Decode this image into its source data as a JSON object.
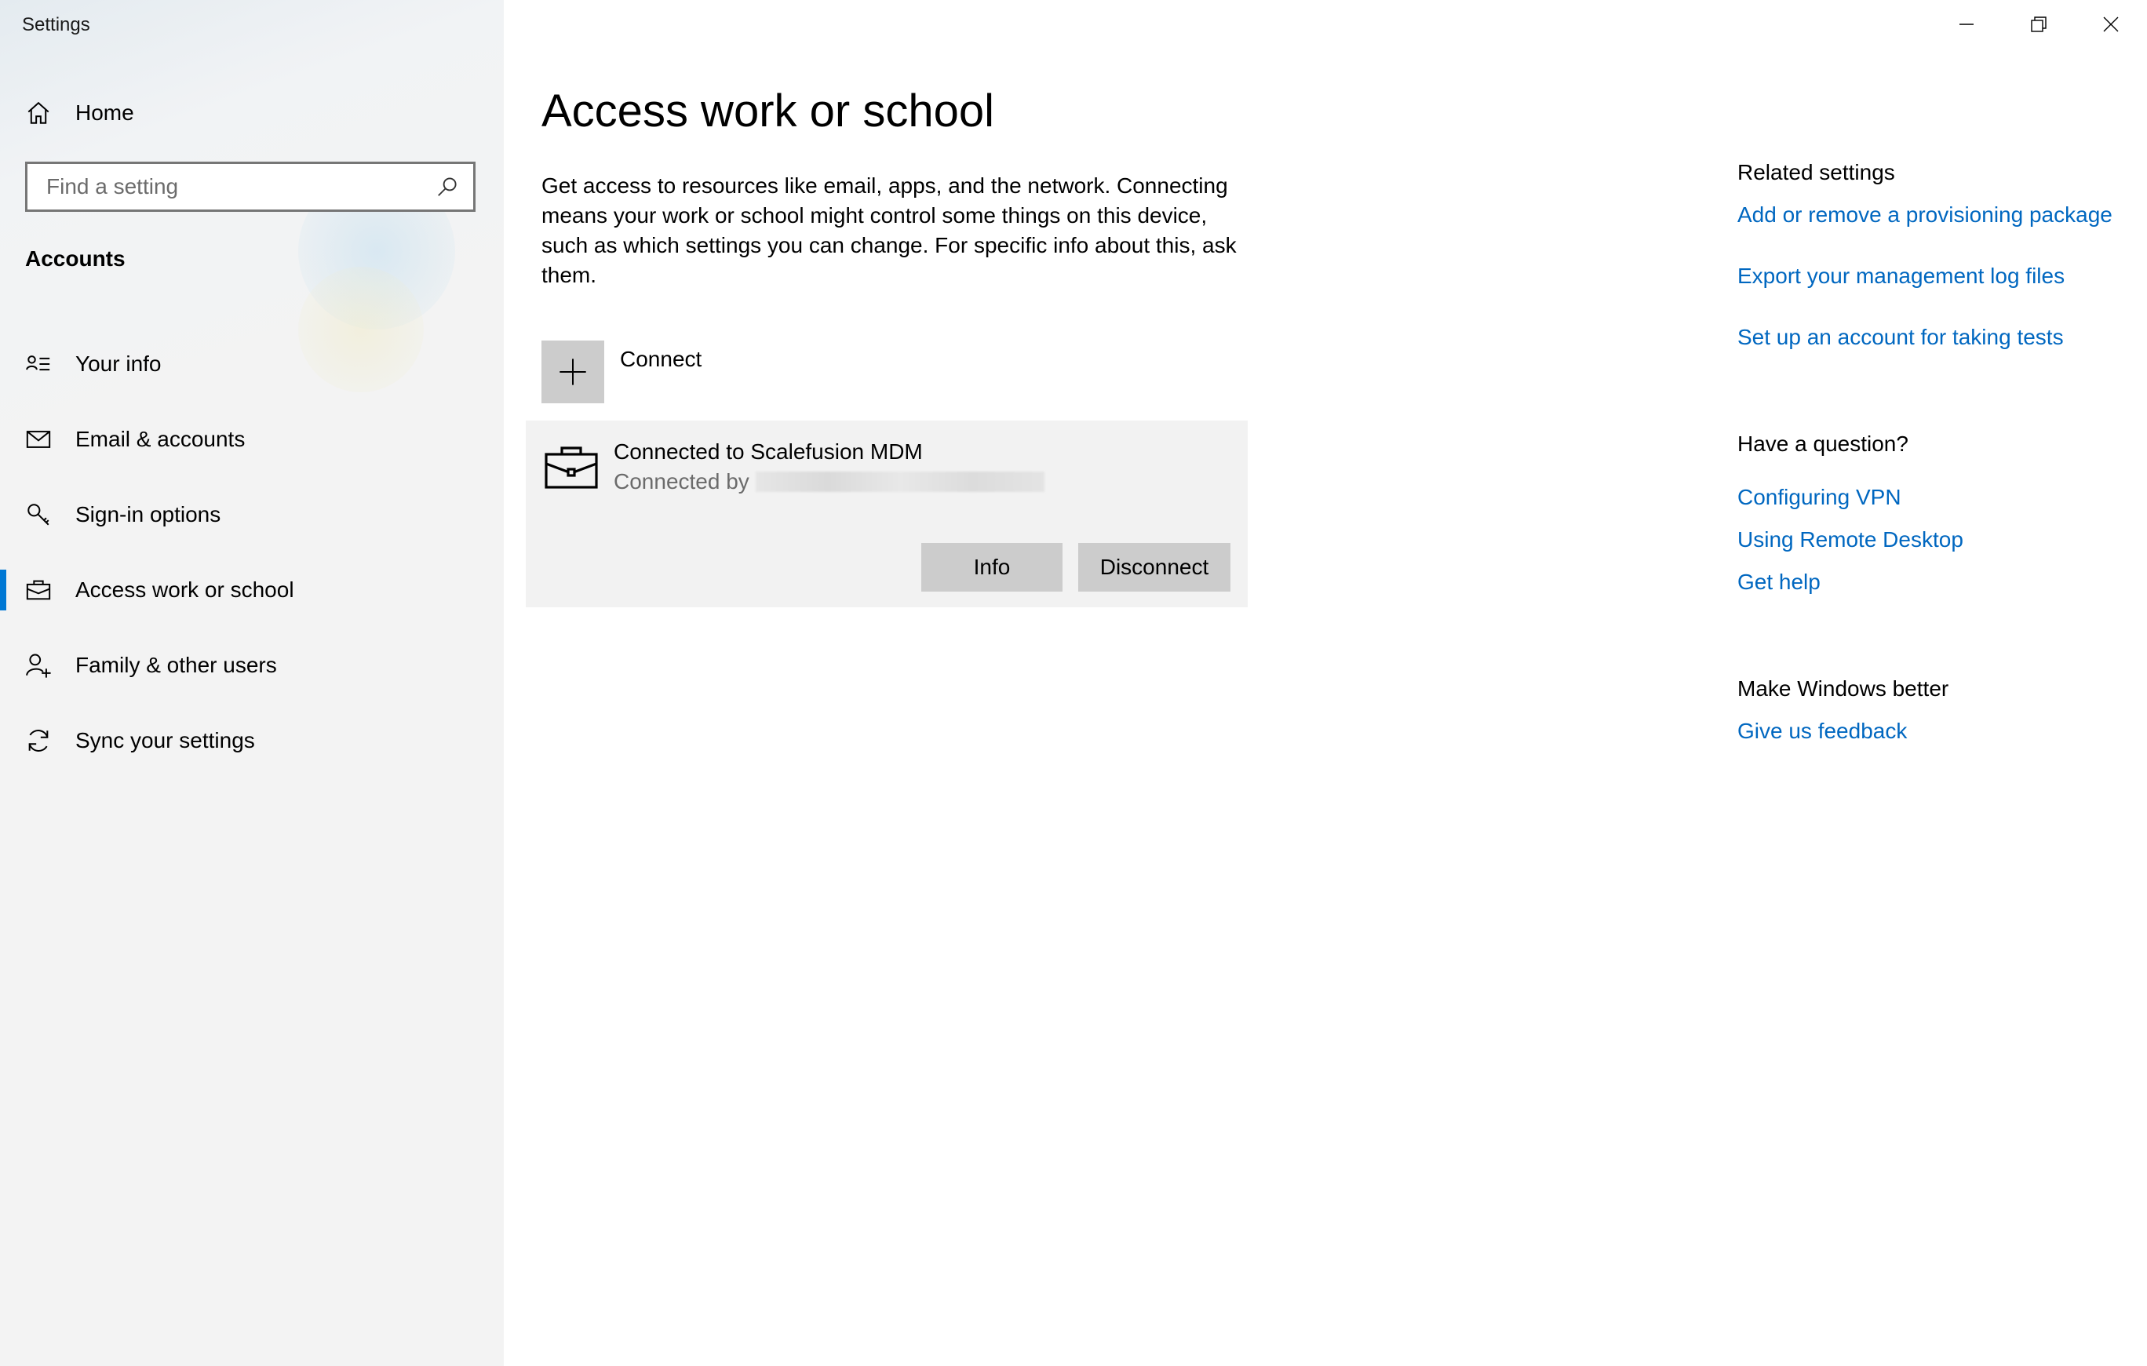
{
  "window": {
    "title": "Settings",
    "controls": [
      "minimize-icon",
      "restore-icon",
      "close-icon"
    ]
  },
  "sidebar": {
    "home_label": "Home",
    "search_placeholder": "Find a setting",
    "section_title": "Accounts",
    "items": [
      {
        "label": "Your info",
        "icon": "person-card-icon",
        "active": false
      },
      {
        "label": "Email & accounts",
        "icon": "mail-icon",
        "active": false
      },
      {
        "label": "Sign-in options",
        "icon": "key-icon",
        "active": false
      },
      {
        "label": "Access work or school",
        "icon": "briefcase-icon",
        "active": true
      },
      {
        "label": "Family & other users",
        "icon": "person-add-icon",
        "active": false
      },
      {
        "label": "Sync your settings",
        "icon": "sync-icon",
        "active": false
      }
    ]
  },
  "main": {
    "title": "Access work or school",
    "description": "Get access to resources like email, apps, and the network. Connecting means your work or school might control some things on this device, such as which settings you can change. For specific info about this, ask them.",
    "connect_label": "Connect",
    "account": {
      "name": "Connected to Scalefusion MDM",
      "sub_prefix": "Connected by",
      "info_button": "Info",
      "disconnect_button": "Disconnect"
    }
  },
  "related": {
    "related_heading": "Related settings",
    "related_links": [
      "Add or remove a provisioning package",
      "Export your management log files",
      "Set up an account for taking tests"
    ],
    "question_heading": "Have a question?",
    "question_links": [
      "Configuring VPN",
      "Using Remote Desktop",
      "Get help"
    ],
    "better_heading": "Make Windows better",
    "better_links": [
      "Give us feedback"
    ]
  },
  "colors": {
    "accent": "#0078d4",
    "link": "#0067c0",
    "sidebar_bg": "#f3f3f3",
    "card_bg": "#f2f2f2",
    "button_bg": "#cccccc"
  }
}
